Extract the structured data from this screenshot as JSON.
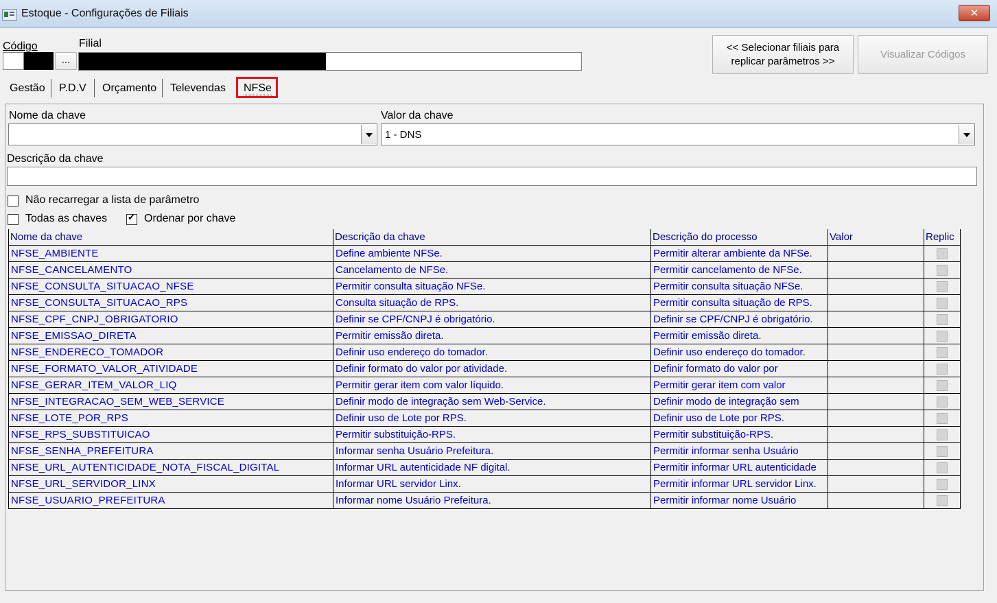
{
  "window": {
    "title": "Estoque - Configurações de Filiais",
    "close_label": "✕"
  },
  "header": {
    "codigo_label": "Código",
    "filial_label": "Filial",
    "ellipsis_label": "...",
    "replicar_button": "<< Selecionar filiais para replicar parâmetros >>",
    "visualizar_button": "Visualizar Códigos"
  },
  "tabs": [
    "Gestão",
    "P.D.V",
    "Orçamento",
    "Televendas",
    "NFSe"
  ],
  "form": {
    "nome_chave_label": "Nome da chave",
    "nome_chave_value": "",
    "valor_chave_label": "Valor da chave",
    "valor_chave_value": "1 - DNS",
    "descricao_chave_label": "Descrição da chave",
    "descricao_chave_value": "",
    "nao_recarregar_label": "Não recarregar a lista de parâmetro",
    "nao_recarregar_checked": false,
    "todas_chaves_label": "Todas as chaves",
    "todas_chaves_checked": false,
    "ordenar_label": "Ordenar por chave",
    "ordenar_checked": true
  },
  "grid": {
    "columns": [
      "Nome da chave",
      "Descrição  da chave",
      "Descrição do processo",
      "Valor",
      "Replic"
    ],
    "rows": [
      [
        "NFSE_AMBIENTE",
        "Define ambiente NFSe.",
        "Permitir alterar ambiente da NFSe.",
        ""
      ],
      [
        "NFSE_CANCELAMENTO",
        "Cancelamento de NFSe.",
        "Permitir cancelamento de NFSe.",
        ""
      ],
      [
        "NFSE_CONSULTA_SITUACAO_NFSE",
        "Permitir consulta situação NFSe.",
        "Permitir consulta situação NFSe.",
        ""
      ],
      [
        "NFSE_CONSULTA_SITUACAO_RPS",
        "Consulta situação de RPS.",
        "Permitir consulta situação de RPS.",
        ""
      ],
      [
        "NFSE_CPF_CNPJ_OBRIGATORIO",
        "Definir se CPF/CNPJ é obrigatório.",
        "Definir se CPF/CNPJ é obrigatório.",
        ""
      ],
      [
        "NFSE_EMISSAO_DIRETA",
        "Permitir emissão direta.",
        "Permitir emissão direta.",
        ""
      ],
      [
        "NFSE_ENDERECO_TOMADOR",
        "Definir uso endereço do tomador.",
        "Definir uso endereço do tomador.",
        ""
      ],
      [
        "NFSE_FORMATO_VALOR_ATIVIDADE",
        "Definir formato do valor por atividade.",
        "Definir formato do valor por",
        ""
      ],
      [
        "NFSE_GERAR_ITEM_VALOR_LIQ",
        "Permitir gerar item com valor líquido.",
        "Permitir gerar item com valor",
        ""
      ],
      [
        "NFSE_INTEGRACAO_SEM_WEB_SERVICE",
        "Definir modo de integração sem Web-Service.",
        "Definir modo de integração sem",
        ""
      ],
      [
        "NFSE_LOTE_POR_RPS",
        "Definir uso de Lote por RPS.",
        "Definir uso de Lote por RPS.",
        ""
      ],
      [
        "NFSE_RPS_SUBSTITUICAO",
        "Permitir substituição-RPS.",
        "Permitir substituição-RPS.",
        ""
      ],
      [
        "NFSE_SENHA_PREFEITURA",
        "Informar senha Usuário Prefeitura.",
        "Permitir informar senha Usuário",
        ""
      ],
      [
        "NFSE_URL_AUTENTICIDADE_NOTA_FISCAL_DIGITAL",
        "Informar URL autenticidade NF digital.",
        "Permitir informar URL autenticidade",
        ""
      ],
      [
        "NFSE_URL_SERVIDOR_LINX",
        "Informar URL servidor Linx.",
        "Permitir informar URL servidor Linx.",
        ""
      ],
      [
        "NFSE_USUARIO_PREFEITURA",
        "Informar nome Usuário Prefeitura.",
        "Permitir informar nome Usuário",
        ""
      ]
    ]
  },
  "colors": {
    "link_blue": "#0000cc",
    "header_blue": "#00008b",
    "highlight_red": "#e8141c"
  }
}
